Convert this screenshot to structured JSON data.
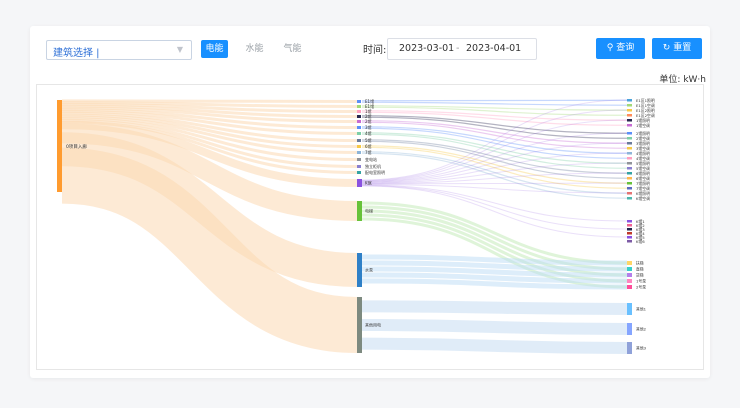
{
  "building_select": {
    "value": "建筑选择 |"
  },
  "tabs": [
    {
      "label": "电能",
      "active": true
    },
    {
      "label": "水能",
      "active": false
    },
    {
      "label": "气能",
      "active": false
    }
  ],
  "time": {
    "label": "时间:",
    "start": "2023-03-01",
    "separator": "-",
    "end": "2023-04-01"
  },
  "buttons": {
    "query": "查询",
    "reset": "重置"
  },
  "unit_label": "单位: kW·h",
  "chart_data": {
    "type": "sankey",
    "colors": {
      "accent": "#1890ff"
    },
    "level1": [
      {
        "name": "0项目入廊",
        "color": "#ff9b2f"
      }
    ],
    "level2": [
      {
        "name": "E1馆",
        "color": "#5b8ff9",
        "value": 2
      },
      {
        "name": "E1馆",
        "color": "#a3d977",
        "value": 2
      },
      {
        "name": "1馆",
        "color": "#ff9fbf",
        "value": 2
      },
      {
        "name": "2馆",
        "color": "#26264d",
        "value": 2
      },
      {
        "name": "2馆",
        "color": "#c76bd3",
        "value": 2
      },
      {
        "name": "3馆",
        "color": "#5b8ff9",
        "value": 2
      },
      {
        "name": "4馆",
        "color": "#7dcfa7",
        "value": 2
      },
      {
        "name": "5馆",
        "color": "#6a7a9a",
        "value": 2
      },
      {
        "name": "6馆",
        "color": "#f7c948",
        "value": 2
      },
      {
        "name": "7馆",
        "color": "#8db4d8",
        "value": 2
      },
      {
        "name": "变电站",
        "color": "#909399",
        "value": 2
      },
      {
        "name": "独立柜机",
        "color": "#8a7fd0",
        "value": 2
      },
      {
        "name": "配电室照明",
        "color": "#34a3a3",
        "value": 2
      },
      {
        "name": "K馆",
        "color": "#8a52e0",
        "value": 8
      },
      {
        "name": "电梯",
        "color": "#67c23a",
        "value": 20
      },
      {
        "name": "水泵",
        "color": "#2f80c7",
        "value": 34
      },
      {
        "name": "其他用电",
        "color": "#7d8a80",
        "value": 56
      }
    ],
    "level3": [
      {
        "name": "E1区1照明",
        "color": "#4ba3d9"
      },
      {
        "name": "E1区1空调",
        "color": "#a3d977"
      },
      {
        "name": "E1区2照明",
        "color": "#f7c948"
      },
      {
        "name": "E1区2空调",
        "color": "#ff8c5a"
      },
      {
        "name": "1馆照明",
        "color": "#26264d"
      },
      {
        "name": "1馆空调",
        "color": "#c76bd3"
      },
      {
        "name": "2馆照明",
        "color": "#5b8ff9"
      },
      {
        "name": "2馆空调",
        "color": "#7dcfa7"
      },
      {
        "name": "3馆照明",
        "color": "#6a7a9a"
      },
      {
        "name": "3馆空调",
        "color": "#f7c948"
      },
      {
        "name": "4馆照明",
        "color": "#8db4d8"
      },
      {
        "name": "4馆空调",
        "color": "#ff9fbf"
      },
      {
        "name": "5馆照明",
        "color": "#909399"
      },
      {
        "name": "5馆空调",
        "color": "#8a7fd0"
      },
      {
        "name": "6馆照明",
        "color": "#34a3a3"
      },
      {
        "name": "6馆空调",
        "color": "#ffb74d"
      },
      {
        "name": "7馆照明",
        "color": "#67c23a"
      },
      {
        "name": "7馆空调",
        "color": "#5c6bc0"
      },
      {
        "name": "K馆照明",
        "color": "#e57373"
      },
      {
        "name": "K馆空调",
        "color": "#4db6ac"
      },
      {
        "name": "K馆1",
        "color": "#8a52e0"
      },
      {
        "name": "K馆2",
        "color": "#f06292"
      },
      {
        "name": "K馆3",
        "color": "#26264d"
      },
      {
        "name": "K馆4",
        "color": "#c0392b"
      },
      {
        "name": "K馆5",
        "color": "#8a52e0"
      },
      {
        "name": "K馆6",
        "color": "#7d5ba6"
      },
      {
        "name": "扶梯",
        "color": "#ffd666"
      },
      {
        "name": "直梯",
        "color": "#36cfc9"
      },
      {
        "name": "货梯",
        "color": "#b37feb"
      },
      {
        "name": "1号泵",
        "color": "#ff85c0"
      },
      {
        "name": "2号泵",
        "color": "#ff4d9a"
      },
      {
        "name": "其他1",
        "color": "#69c0ff"
      },
      {
        "name": "其他2",
        "color": "#85a5ff"
      },
      {
        "name": "其他3",
        "color": "#8fa1d9"
      }
    ]
  }
}
